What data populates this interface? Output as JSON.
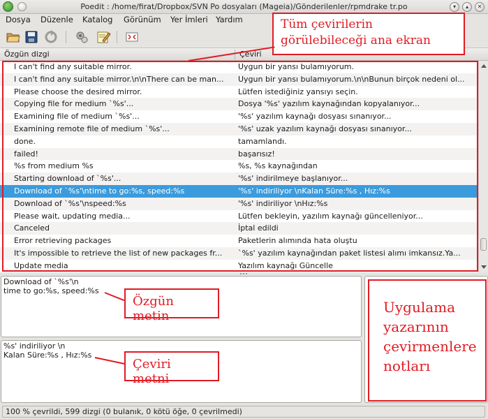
{
  "window": {
    "title": "Poedit : /home/firat/Dropbox/SVN Po dosyaları (Mageia)/Gönderilenler/rpmdrake tr.po",
    "icon": "poedit-app-icon",
    "controls": [
      "minimize-button",
      "maximize-button",
      "close-button"
    ]
  },
  "menu": [
    "Dosya",
    "Düzenle",
    "Katalog",
    "Görünüm",
    "Yer İmleri",
    "Yardım"
  ],
  "toolbar": {
    "buttons": [
      "open-icon",
      "save-icon",
      "validate-icon",
      "update-catalog-icon",
      "edit-comment-icon",
      "fullscreen-icon"
    ]
  },
  "columns": {
    "source": "Özgün dizgi",
    "translation": "Çeviri"
  },
  "rows": [
    {
      "source": "I can't find any suitable mirror.",
      "translation": "Uygun bir yansı bulamıyorum."
    },
    {
      "source": "I can't find any suitable mirror.\\n\\nThere can be man...",
      "translation": "Uygun bir yansı bulamıyorum.\\n\\nBunun birçok nedeni ol..."
    },
    {
      "source": "Please choose the desired mirror.",
      "translation": "Lütfen istediğiniz yansıyı seçin."
    },
    {
      "source": "Copying file for medium `%s'...",
      "translation": "Dosya '%s' yazılım kaynağından kopyalanıyor..."
    },
    {
      "source": "Examining file of medium `%s'...",
      "translation": "'%s' yazılım kaynağı dosyası sınanıyor..."
    },
    {
      "source": "Examining remote file of medium `%s'...",
      "translation": "'%s' uzak yazılım kaynağı dosyası sınanıyor..."
    },
    {
      "source": " done.",
      "translation": " tamamlandı."
    },
    {
      "source": " failed!",
      "translation": " başarısız!"
    },
    {
      "source": "%s from medium %s",
      "translation": "%s, %s kaynağından"
    },
    {
      "source": "Starting download of `%s'...",
      "translation": "'%s' indirilmeye başlanıyor..."
    },
    {
      "source": "Download of `%s'\\ntime to go:%s, speed:%s",
      "translation": "'%s' indiriliyor \\nKalan Süre:%s , Hız:%s",
      "selected": true
    },
    {
      "source": "Download of `%s'\\nspeed:%s",
      "translation": "'%s' indiriliyor \\nHız:%s"
    },
    {
      "source": "Please wait, updating media...",
      "translation": "Lütfen bekleyin, yazılım kaynağı güncelleniyor..."
    },
    {
      "source": "Canceled",
      "translation": "İptal edildi"
    },
    {
      "source": "Error retrieving packages",
      "translation": "Paketlerin alımında hata oluştu"
    },
    {
      "source": "It's impossible to retrieve the list of new packages fr...",
      "translation": "`%s' yazılım kaynağından paket listesi alımı imkansız.Ya..."
    },
    {
      "source": "Update media",
      "translation": "Yazılım kaynağı Güncelle"
    }
  ],
  "source_editor": {
    "text": "Download of `%s'\\n\ntime to go:%s, speed:%s"
  },
  "translation_editor": {
    "text": "%s' indiriliyor \\n\nKalan Süre:%s , Hız:%s"
  },
  "status": "100 % çevrildi, 599 dizgi (0 bulanık, 0 kötü öğe, 0 çevrilmedi)",
  "annotations": {
    "main_view": "Tüm çevirilerin görülebileceği ana ekran",
    "source_text": "Özgün metin",
    "translation_text": "Çeviri metni",
    "notes": "Uygulama yazarının çevirmenlere notları"
  },
  "colors": {
    "selection": "#3b9bdc",
    "annotation": "#e01b24"
  }
}
